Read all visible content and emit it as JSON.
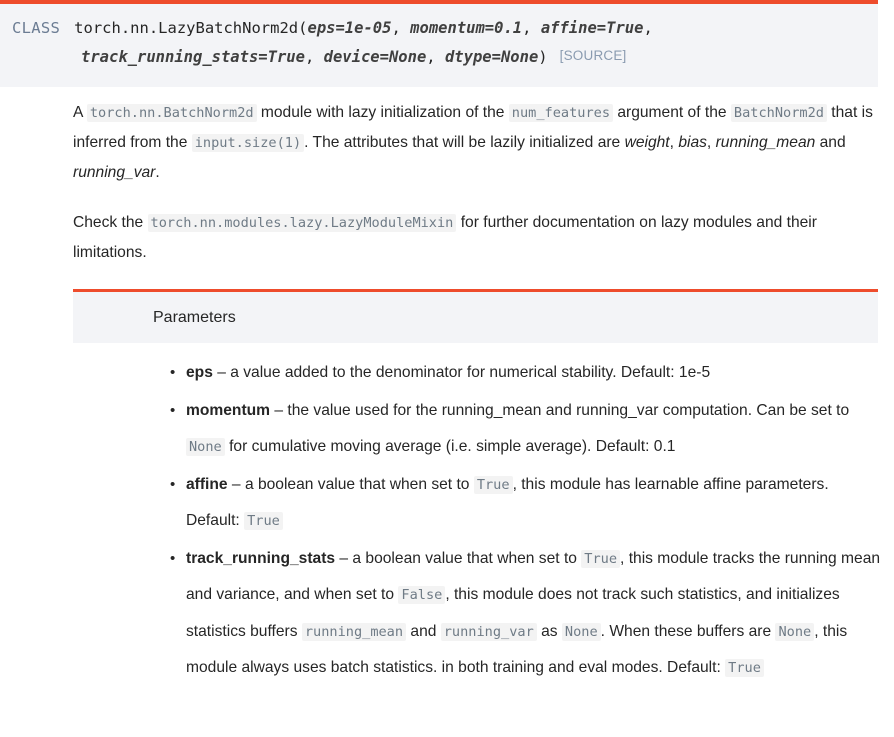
{
  "signature": {
    "kind_label": "CLASS",
    "qualified_name": "torch.nn.LazyBatchNorm2d",
    "open_paren": "(",
    "close_paren": ")",
    "params_line1": [
      {
        "text": "eps=1e-05",
        "sep": ", "
      },
      {
        "text": "momentum=0.1",
        "sep": ", "
      },
      {
        "text": "affine=True",
        "sep": ","
      }
    ],
    "params_line2": [
      {
        "text": "track_running_stats=True",
        "sep": ", "
      },
      {
        "text": "device=None",
        "sep": ", "
      },
      {
        "text": "dtype=None",
        "sep": ""
      }
    ],
    "source_label": "[SOURCE]"
  },
  "description": {
    "p1": {
      "t0": "A ",
      "c1": "torch.nn.BatchNorm2d",
      "t1": " module with lazy initialization of the ",
      "c2": "num_features",
      "t2": " argument of the ",
      "c3": "BatchNorm2d",
      "t3": " that is inferred from the ",
      "c4": "input.size(1)",
      "t4": ". The attributes that will be lazily initialized are ",
      "e1": "weight",
      "t5": ", ",
      "e2": "bias",
      "t6": ", ",
      "e3": "running_mean",
      "t7": " and ",
      "e4": "running_var",
      "t8": "."
    },
    "p2": {
      "t0": "Check the ",
      "c1": "torch.nn.modules.lazy.LazyModuleMixin",
      "t1": " for further documentation on lazy modules and their limitations."
    }
  },
  "parameters_section": {
    "title": "Parameters",
    "bullet_glyph": "•",
    "items": [
      {
        "name": "eps",
        "dash": " – ",
        "desc_parts": [
          {
            "type": "text",
            "value": "a value added to the denominator for numerical stability. Default: 1e-5"
          }
        ]
      },
      {
        "name": "momentum",
        "dash": " – ",
        "desc_parts": [
          {
            "type": "text",
            "value": "the value used for the running_mean and running_var computation. Can be set to "
          },
          {
            "type": "code",
            "value": "None"
          },
          {
            "type": "text",
            "value": " for cumulative moving average (i.e. simple average). Default: 0.1"
          }
        ]
      },
      {
        "name": "affine",
        "dash": " – ",
        "desc_parts": [
          {
            "type": "text",
            "value": "a boolean value that when set to "
          },
          {
            "type": "code",
            "value": "True"
          },
          {
            "type": "text",
            "value": ", this module has learnable affine parameters. Default: "
          },
          {
            "type": "code",
            "value": "True"
          }
        ]
      },
      {
        "name": "track_running_stats",
        "dash": " – ",
        "desc_parts": [
          {
            "type": "text",
            "value": "a boolean value that when set to "
          },
          {
            "type": "code",
            "value": "True"
          },
          {
            "type": "text",
            "value": ", this module tracks the running mean and variance, and when set to "
          },
          {
            "type": "code",
            "value": "False"
          },
          {
            "type": "text",
            "value": ", this module does not track such statistics, and initializes statistics buffers "
          },
          {
            "type": "code",
            "value": "running_mean"
          },
          {
            "type": "text",
            "value": " and "
          },
          {
            "type": "code",
            "value": "running_var"
          },
          {
            "type": "text",
            "value": " as "
          },
          {
            "type": "code",
            "value": "None"
          },
          {
            "type": "text",
            "value": ". When these buffers are "
          },
          {
            "type": "code",
            "value": "None"
          },
          {
            "type": "text",
            "value": ", this module always uses batch statistics. in both training and eval modes. Default: "
          },
          {
            "type": "code",
            "value": "True"
          }
        ]
      }
    ]
  },
  "colors": {
    "accent": "#ee4c2c",
    "panel_bg": "#f3f4f7",
    "code_bg": "#f3f3f3",
    "code_fg": "#6f7b86",
    "text": "#262626",
    "muted": "#8a9bb0"
  }
}
